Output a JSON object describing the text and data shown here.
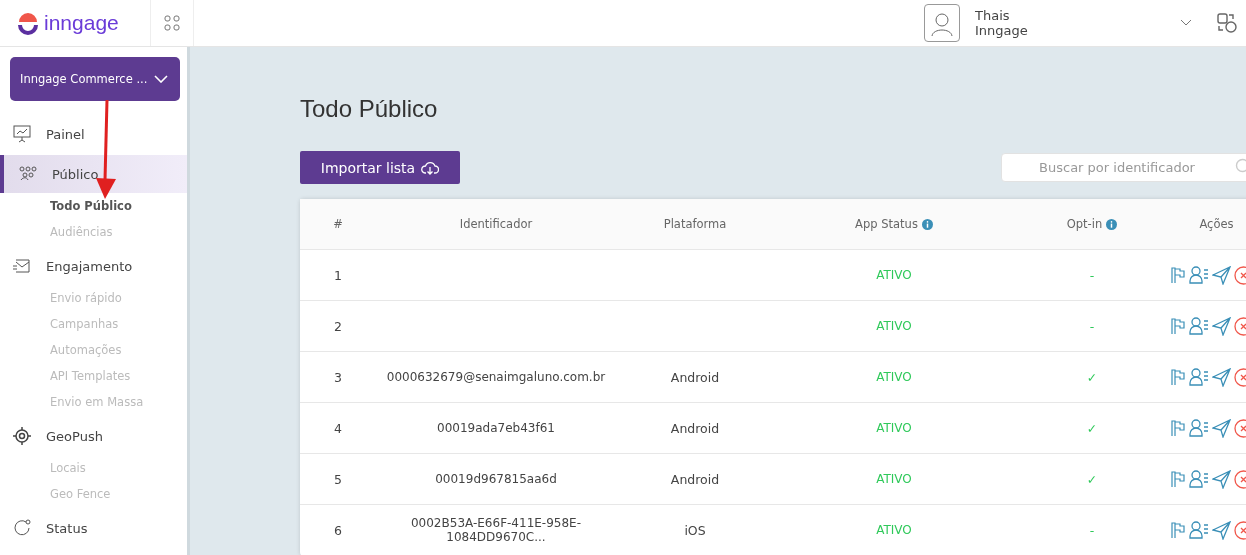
{
  "header": {
    "brand": "inngage",
    "user": {
      "name": "Thais",
      "company": "Inngage"
    }
  },
  "sidebar": {
    "workspace": "Inngage Commerce ...",
    "items": [
      {
        "label": "Painel",
        "selected": false
      },
      {
        "label": "Público",
        "selected": true,
        "children": [
          {
            "label": "Todo Público",
            "selected": true
          },
          {
            "label": "Audiências",
            "selected": false
          }
        ]
      },
      {
        "label": "Engajamento",
        "selected": false,
        "children": [
          {
            "label": "Envio rápido",
            "selected": false
          },
          {
            "label": "Campanhas",
            "selected": false
          },
          {
            "label": "Automações",
            "selected": false
          },
          {
            "label": "API Templates",
            "selected": false
          },
          {
            "label": "Envio em Massa",
            "selected": false
          }
        ]
      },
      {
        "label": "GeoPush",
        "selected": false,
        "children": [
          {
            "label": "Locais",
            "selected": false
          },
          {
            "label": "Geo Fence",
            "selected": false
          }
        ]
      },
      {
        "label": "Status",
        "selected": false
      }
    ]
  },
  "page": {
    "title": "Todo Público",
    "import_button": "Importar lista",
    "search": {
      "placeholder": "Buscar por identificador"
    }
  },
  "table": {
    "columns": [
      {
        "label": "#",
        "info": false
      },
      {
        "label": "Identificador",
        "info": false
      },
      {
        "label": "Plataforma",
        "info": false
      },
      {
        "label": "App Status",
        "info": true
      },
      {
        "label": "Opt-in",
        "info": true
      },
      {
        "label": "Ações",
        "info": false
      }
    ],
    "rows": [
      {
        "n": "1",
        "id": "",
        "platform": "",
        "status": "ATIVO",
        "optin": "-"
      },
      {
        "n": "2",
        "id": "",
        "platform": "",
        "status": "ATIVO",
        "optin": "-"
      },
      {
        "n": "3",
        "id": "0000632679@senaimgaluno.com.br",
        "platform": "Android",
        "status": "ATIVO",
        "optin": "✓"
      },
      {
        "n": "4",
        "id": "00019ada7eb43f61",
        "platform": "Android",
        "status": "ATIVO",
        "optin": "✓"
      },
      {
        "n": "5",
        "id": "00019d967815aa6d",
        "platform": "Android",
        "status": "ATIVO",
        "optin": "✓"
      },
      {
        "n": "6",
        "id": "0002B53A-E66F-411E-958E-1084DD9670C...",
        "platform": "iOS",
        "status": "ATIVO",
        "optin": "-"
      }
    ]
  }
}
